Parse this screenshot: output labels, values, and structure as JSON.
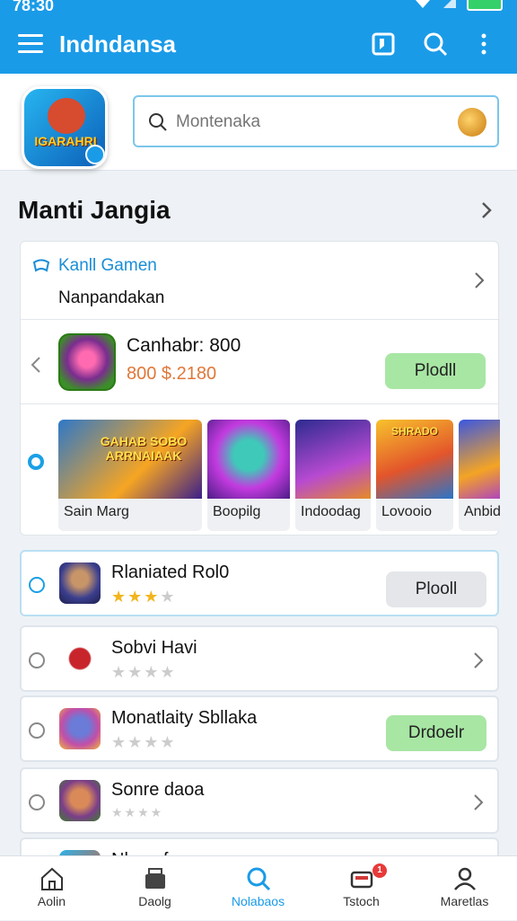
{
  "status_bar": {
    "time": "78:30"
  },
  "app_bar": {
    "title": "Indndansa"
  },
  "search": {
    "placeholder": "Montenaka"
  },
  "app_logo_text": "IGARAHRI",
  "section": {
    "title": "Manti Jangia"
  },
  "featured_card": {
    "header_primary": "Kanll Gamen",
    "header_secondary": "Nanpandakan",
    "featured_app": {
      "name": "Canhabr: 800",
      "price": "800 $.2180",
      "action": "Plodll"
    },
    "carousel": [
      {
        "caption": "Sain Marg",
        "logo_text": "GAHAB SOBO ARRNAIAAK"
      },
      {
        "caption": "Boopilg"
      },
      {
        "caption": "Indoodag"
      },
      {
        "caption": "Lovooio",
        "logo_text": "SHRADO"
      },
      {
        "caption": "Anbid"
      }
    ]
  },
  "list": [
    {
      "name": "Rlaniated Rol0",
      "rating": 3,
      "action": "Plooll",
      "action_style": "grey"
    },
    {
      "name": "Sobvi Havi",
      "rating": 0,
      "action": null
    },
    {
      "name": "Monatlaity Sbllaka",
      "rating": 0,
      "action": "Drdoelr",
      "action_style": "green"
    },
    {
      "name": "Sonre daoa",
      "rating": 0,
      "action": null
    },
    {
      "name": "Nlaea fann",
      "rating": 0,
      "action": null
    }
  ],
  "bottom_nav": [
    {
      "label": "Aolin",
      "icon": "home-icon"
    },
    {
      "label": "Daolg",
      "icon": "store-icon"
    },
    {
      "label": "Nolabaos",
      "icon": "search-icon",
      "active": true
    },
    {
      "label": "Tstoch",
      "icon": "inbox-icon",
      "badge": "1"
    },
    {
      "label": "Maretlas",
      "icon": "profile-icon"
    }
  ],
  "colors": {
    "primary": "#1a9be8",
    "install_green": "#a8e6a4",
    "price_orange": "#e0773a",
    "star": "#f2b51c"
  }
}
